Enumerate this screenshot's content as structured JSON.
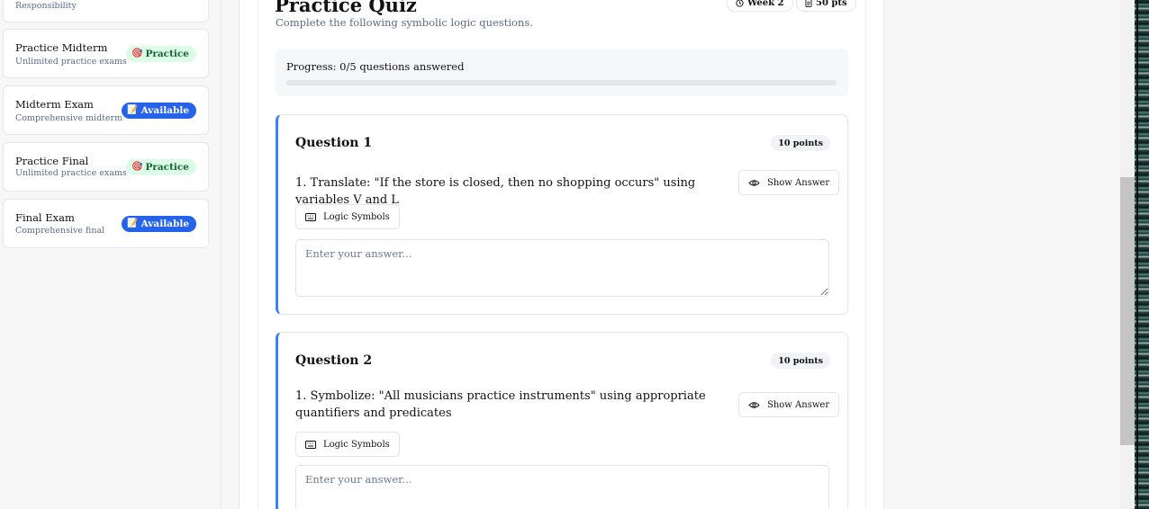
{
  "sidebar": {
    "items": [
      {
        "title": "",
        "subtitle": "Responsibility",
        "badge": "",
        "badge_type": ""
      },
      {
        "title": "Practice Midterm",
        "subtitle": "Unlimited practice exams",
        "badge": "Practice",
        "badge_type": "practice",
        "badge_icon": "🎯"
      },
      {
        "title": "Midterm Exam",
        "subtitle": "Comprehensive midterm",
        "badge": "Available",
        "badge_type": "available",
        "badge_icon": "📝"
      },
      {
        "title": "Practice Final",
        "subtitle": "Unlimited practice exams",
        "badge": "Practice",
        "badge_type": "practice",
        "badge_icon": "🎯"
      },
      {
        "title": "Final Exam",
        "subtitle": "Comprehensive final",
        "badge": "Available",
        "badge_type": "available",
        "badge_icon": "📝"
      }
    ]
  },
  "quiz": {
    "title": "Practice Quiz",
    "subtitle": "Complete the following symbolic logic questions.",
    "week_label": "Week 2",
    "points_label": "50 pts",
    "progress_text": "Progress: 0/5 questions answered",
    "progress_fraction": 0
  },
  "questions": [
    {
      "title": "Question 1",
      "points": "10 points",
      "text": "1. Translate: \"If the store is closed, then no shopping occurs\" using variables V and L",
      "show_answer_label": "Show Answer",
      "symbols_label": "Logic Symbols",
      "answer_placeholder": "Enter your answer...",
      "answer_value": ""
    },
    {
      "title": "Question 2",
      "points": "10 points",
      "text": "1. Symbolize: \"All musicians practice instruments\" using appropriate quantifiers and predicates",
      "show_answer_label": "Show Answer",
      "symbols_label": "Logic Symbols",
      "answer_placeholder": "Enter your answer...",
      "answer_value": ""
    }
  ],
  "colors": {
    "accent": "#3b82f6",
    "available_badge": "#2563eb",
    "practice_badge_bg": "#dcfce7",
    "practice_badge_text": "#166534"
  }
}
